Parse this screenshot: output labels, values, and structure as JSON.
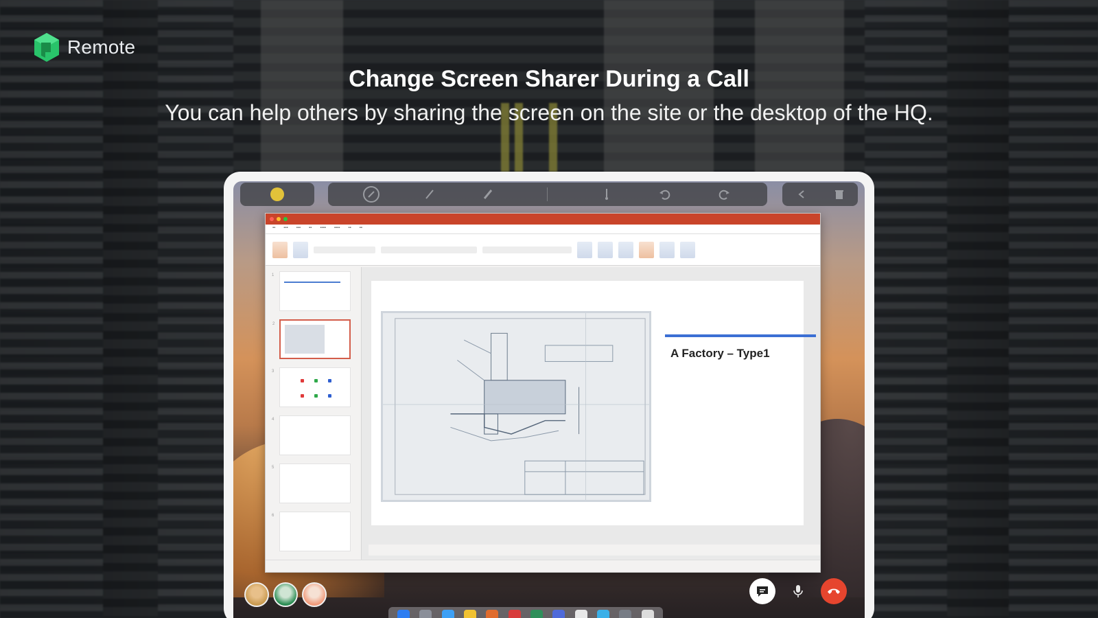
{
  "brand": {
    "name": "Remote",
    "accent": "#29c36a"
  },
  "hero": {
    "title": "Change Screen Sharer During a Call",
    "subtitle": "You can help others by sharing the screen on the site or the desktop of the HQ."
  },
  "annotation_toolbar": {
    "icons": [
      "pointer-icon",
      "pen-icon",
      "highlighter-icon",
      "separator",
      "laser-icon",
      "undo-icon",
      "redo-icon"
    ],
    "right_icons": [
      "back-icon",
      "trash-icon"
    ]
  },
  "ppt": {
    "selected_slide": 2,
    "slide_count": 6,
    "slide": {
      "heading": "A Factory – Type1",
      "accent": "#3b6fd4"
    }
  },
  "call_controls": {
    "icons": [
      "chat-icon",
      "microphone-icon",
      "hang-up-icon"
    ],
    "hang_up_color": "#e6452e"
  },
  "participants": [
    "avatar-1",
    "avatar-2",
    "avatar-3"
  ]
}
